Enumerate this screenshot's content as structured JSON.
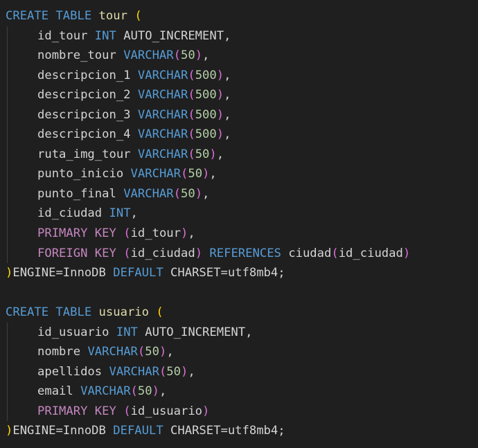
{
  "editor": {
    "background": "#1f1f1f",
    "colors": {
      "keyword": "#569cd6",
      "keyword_constraint": "#c586c0",
      "table_name": "#dcdcaa",
      "identifier": "#d4d4d4",
      "number": "#b5cea8",
      "bracket_level_1": "#ffd700",
      "bracket_level_2": "#da70d6",
      "bracket_level_3": "#179fff"
    },
    "lines": [
      {
        "indent": false,
        "tokens": [
          {
            "t": "CREATE TABLE",
            "c": "kw"
          },
          {
            "t": " "
          },
          {
            "t": "tour",
            "c": "tbl"
          },
          {
            "t": " "
          },
          {
            "t": "(",
            "c": "p-y"
          }
        ]
      },
      {
        "indent": true,
        "tokens": [
          {
            "t": "id_tour",
            "c": "id"
          },
          {
            "t": " "
          },
          {
            "t": "INT",
            "c": "kw"
          },
          {
            "t": " AUTO_INCREMENT,",
            "c": "id"
          }
        ]
      },
      {
        "indent": true,
        "tokens": [
          {
            "t": "nombre_tour",
            "c": "id"
          },
          {
            "t": " "
          },
          {
            "t": "VARCHAR",
            "c": "kw"
          },
          {
            "t": "(",
            "c": "p-m"
          },
          {
            "t": "50",
            "c": "num"
          },
          {
            "t": ")",
            "c": "p-m"
          },
          {
            "t": ",",
            "c": "pn"
          }
        ]
      },
      {
        "indent": true,
        "tokens": [
          {
            "t": "descripcion_1",
            "c": "id"
          },
          {
            "t": " "
          },
          {
            "t": "VARCHAR",
            "c": "kw"
          },
          {
            "t": "(",
            "c": "p-m"
          },
          {
            "t": "500",
            "c": "num"
          },
          {
            "t": ")",
            "c": "p-m"
          },
          {
            "t": ",",
            "c": "pn"
          }
        ]
      },
      {
        "indent": true,
        "tokens": [
          {
            "t": "descripcion_2",
            "c": "id"
          },
          {
            "t": " "
          },
          {
            "t": "VARCHAR",
            "c": "kw"
          },
          {
            "t": "(",
            "c": "p-m"
          },
          {
            "t": "500",
            "c": "num"
          },
          {
            "t": ")",
            "c": "p-m"
          },
          {
            "t": ",",
            "c": "pn"
          }
        ]
      },
      {
        "indent": true,
        "tokens": [
          {
            "t": "descripcion_3",
            "c": "id"
          },
          {
            "t": " "
          },
          {
            "t": "VARCHAR",
            "c": "kw"
          },
          {
            "t": "(",
            "c": "p-m"
          },
          {
            "t": "500",
            "c": "num"
          },
          {
            "t": ")",
            "c": "p-m"
          },
          {
            "t": ",",
            "c": "pn"
          }
        ]
      },
      {
        "indent": true,
        "tokens": [
          {
            "t": "descripcion_4",
            "c": "id"
          },
          {
            "t": " "
          },
          {
            "t": "VARCHAR",
            "c": "kw"
          },
          {
            "t": "(",
            "c": "p-m"
          },
          {
            "t": "500",
            "c": "num"
          },
          {
            "t": ")",
            "c": "p-m"
          },
          {
            "t": ",",
            "c": "pn"
          }
        ]
      },
      {
        "indent": true,
        "tokens": [
          {
            "t": "ruta_img_tour",
            "c": "id"
          },
          {
            "t": " "
          },
          {
            "t": "VARCHAR",
            "c": "kw"
          },
          {
            "t": "(",
            "c": "p-m"
          },
          {
            "t": "50",
            "c": "num"
          },
          {
            "t": ")",
            "c": "p-m"
          },
          {
            "t": ",",
            "c": "pn"
          }
        ]
      },
      {
        "indent": true,
        "tokens": [
          {
            "t": "punto_inicio",
            "c": "id"
          },
          {
            "t": " "
          },
          {
            "t": "VARCHAR",
            "c": "kw"
          },
          {
            "t": "(",
            "c": "p-m"
          },
          {
            "t": "50",
            "c": "num"
          },
          {
            "t": ")",
            "c": "p-m"
          },
          {
            "t": ",",
            "c": "pn"
          }
        ]
      },
      {
        "indent": true,
        "tokens": [
          {
            "t": "punto_final",
            "c": "id"
          },
          {
            "t": " "
          },
          {
            "t": "VARCHAR",
            "c": "kw"
          },
          {
            "t": "(",
            "c": "p-m"
          },
          {
            "t": "50",
            "c": "num"
          },
          {
            "t": ")",
            "c": "p-m"
          },
          {
            "t": ",",
            "c": "pn"
          }
        ]
      },
      {
        "indent": true,
        "tokens": [
          {
            "t": "id_ciudad",
            "c": "id"
          },
          {
            "t": " "
          },
          {
            "t": "INT",
            "c": "kw"
          },
          {
            "t": ",",
            "c": "pn"
          }
        ]
      },
      {
        "indent": true,
        "tokens": [
          {
            "t": "PRIMARY KEY",
            "c": "kwp"
          },
          {
            "t": " "
          },
          {
            "t": "(",
            "c": "p-m"
          },
          {
            "t": "id_tour",
            "c": "id"
          },
          {
            "t": ")",
            "c": "p-m"
          },
          {
            "t": ",",
            "c": "pn"
          }
        ]
      },
      {
        "indent": true,
        "tokens": [
          {
            "t": "FOREIGN KEY",
            "c": "kwp"
          },
          {
            "t": " "
          },
          {
            "t": "(",
            "c": "p-m"
          },
          {
            "t": "id_ciudad",
            "c": "id"
          },
          {
            "t": ")",
            "c": "p-m"
          },
          {
            "t": " "
          },
          {
            "t": "REFERENCES",
            "c": "kw"
          },
          {
            "t": " "
          },
          {
            "t": "ciudad",
            "c": "id"
          },
          {
            "t": "(",
            "c": "p-m"
          },
          {
            "t": "id_ciudad",
            "c": "id"
          },
          {
            "t": ")",
            "c": "p-m"
          }
        ]
      },
      {
        "indent": false,
        "tokens": [
          {
            "t": ")",
            "c": "p-y"
          },
          {
            "t": "ENGINE=InnoDB",
            "c": "id"
          },
          {
            "t": " "
          },
          {
            "t": "DEFAULT",
            "c": "kw"
          },
          {
            "t": " CHARSET=utf8mb4;",
            "c": "id"
          }
        ]
      },
      {
        "indent": false,
        "tokens": []
      },
      {
        "indent": false,
        "tokens": [
          {
            "t": "CREATE TABLE",
            "c": "kw"
          },
          {
            "t": " "
          },
          {
            "t": "usuario",
            "c": "tbl"
          },
          {
            "t": " "
          },
          {
            "t": "(",
            "c": "p-y"
          }
        ]
      },
      {
        "indent": true,
        "tokens": [
          {
            "t": "id_usuario",
            "c": "id"
          },
          {
            "t": " "
          },
          {
            "t": "INT",
            "c": "kw"
          },
          {
            "t": " AUTO_INCREMENT,",
            "c": "id"
          }
        ]
      },
      {
        "indent": true,
        "tokens": [
          {
            "t": "nombre",
            "c": "id"
          },
          {
            "t": " "
          },
          {
            "t": "VARCHAR",
            "c": "kw"
          },
          {
            "t": "(",
            "c": "p-m"
          },
          {
            "t": "50",
            "c": "num"
          },
          {
            "t": ")",
            "c": "p-m"
          },
          {
            "t": ",",
            "c": "pn"
          }
        ]
      },
      {
        "indent": true,
        "tokens": [
          {
            "t": "apellidos",
            "c": "id"
          },
          {
            "t": " "
          },
          {
            "t": "VARCHAR",
            "c": "kw"
          },
          {
            "t": "(",
            "c": "p-m"
          },
          {
            "t": "50",
            "c": "num"
          },
          {
            "t": ")",
            "c": "p-m"
          },
          {
            "t": ",",
            "c": "pn"
          }
        ]
      },
      {
        "indent": true,
        "tokens": [
          {
            "t": "email",
            "c": "id"
          },
          {
            "t": " "
          },
          {
            "t": "VARCHAR",
            "c": "kw"
          },
          {
            "t": "(",
            "c": "p-m"
          },
          {
            "t": "50",
            "c": "num"
          },
          {
            "t": ")",
            "c": "p-m"
          },
          {
            "t": ",",
            "c": "pn"
          }
        ]
      },
      {
        "indent": true,
        "tokens": [
          {
            "t": "PRIMARY KEY",
            "c": "kwp"
          },
          {
            "t": " "
          },
          {
            "t": "(",
            "c": "p-m"
          },
          {
            "t": "id_usuario",
            "c": "id"
          },
          {
            "t": ")",
            "c": "p-m"
          }
        ]
      },
      {
        "indent": false,
        "tokens": [
          {
            "t": ")",
            "c": "p-y"
          },
          {
            "t": "ENGINE=InnoDB",
            "c": "id"
          },
          {
            "t": " "
          },
          {
            "t": "DEFAULT",
            "c": "kw"
          },
          {
            "t": " CHARSET=utf8mb4;",
            "c": "id"
          }
        ]
      }
    ]
  }
}
